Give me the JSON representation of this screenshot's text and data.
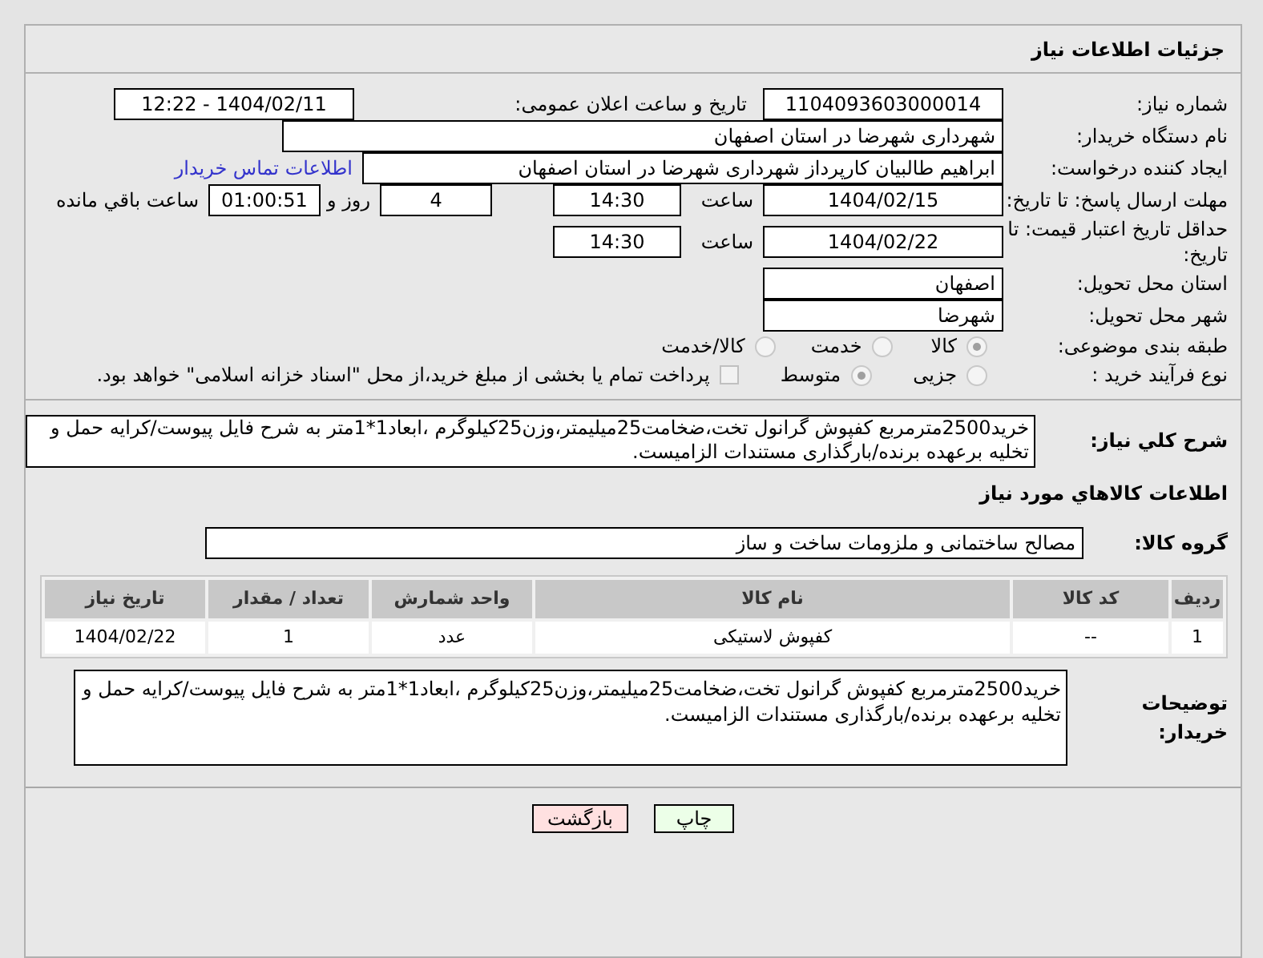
{
  "header": {
    "title": "جزئیات اطلاعات نیاز"
  },
  "fields": {
    "need_number": {
      "label": "شماره نیاز:",
      "value": "1104093603000014"
    },
    "announce": {
      "label": "تاریخ و ساعت اعلان عمومی:",
      "value": "1404/02/11 - 12:22"
    },
    "buyer": {
      "label": "نام دستگاه خریدار:",
      "value": "شهرداری شهرضا در استان اصفهان"
    },
    "creator": {
      "label": "ایجاد کننده درخواست:",
      "value": "ابراهیم طالبیان کارپرداز شهرداری شهرضا در استان اصفهان",
      "link": "اطلاعات تماس خریدار"
    },
    "deadline": {
      "label": "مهلت ارسال پاسخ: تا تاریخ:",
      "date": "1404/02/15",
      "time_label": "ساعت",
      "time": "14:30",
      "days": "4",
      "days_label": "روز و",
      "remaining": "01:00:51",
      "remaining_label": "ساعت باقي مانده"
    },
    "validity": {
      "label": "حداقل تاریخ اعتبار قیمت: تا تاریخ:",
      "date": "1404/02/22",
      "time_label": "ساعت",
      "time": "14:30"
    },
    "province": {
      "label": "استان محل تحویل:",
      "value": "اصفهان"
    },
    "city": {
      "label": "شهر محل تحویل:",
      "value": "شهرضا"
    }
  },
  "category": {
    "label": "طبقه بندی موضوعی:",
    "options": [
      {
        "label": "کالا",
        "selected": true
      },
      {
        "label": "خدمت",
        "selected": false
      },
      {
        "label": "کالا/خدمت",
        "selected": false
      }
    ]
  },
  "purchase_type": {
    "label": "نوع فرآیند خرید :",
    "options": [
      {
        "label": "جزیی",
        "selected": false
      },
      {
        "label": "متوسط",
        "selected": true
      }
    ],
    "payment": {
      "label": "پرداخت تمام یا بخشی از مبلغ خرید،از محل \"اسناد خزانه اسلامی\" خواهد بود.",
      "checked": false
    }
  },
  "description": {
    "label": "شرح کلي نياز:",
    "value": "خرید2500مترمربع کفپوش گرانول تخت،ضخامت25میلیمتر،وزن25کیلوگرم ،ابعاد1*1متر به شرح فایل پیوست/کرایه حمل و تخلیه برعهده برنده/بارگذاری مستندات الزامیست."
  },
  "goods_section": {
    "title": "اطلاعات کالاهاي مورد نياز"
  },
  "goods_group": {
    "label": "گروه کالا:",
    "value": "مصالح ساختمانی و ملزومات ساخت و ساز"
  },
  "table": {
    "columns": [
      "ردیف",
      "کد کالا",
      "نام کالا",
      "واحد شمارش",
      "تعداد / مقدار",
      "تاریخ نیاز"
    ],
    "rows": [
      [
        "1",
        "--",
        "کفپوش لاستیکی",
        "عدد",
        "1",
        "1404/02/22"
      ]
    ]
  },
  "buyer_notes": {
    "label": "توضیحات خریدار:",
    "value": "خرید2500مترمربع کفپوش گرانول تخت،ضخامت25میلیمتر،وزن25کیلوگرم ،ابعاد1*1متر به شرح فایل پیوست/کرایه حمل و تخلیه برعهده برنده/بارگذاری مستندات الزامیست."
  },
  "buttons": [
    {
      "label": "چاپ",
      "kind": "print"
    },
    {
      "label": "بازگشت",
      "kind": "back"
    }
  ]
}
